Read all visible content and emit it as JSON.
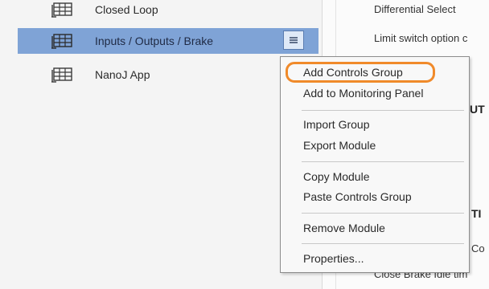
{
  "tree": {
    "items": [
      {
        "label": "Closed Loop"
      },
      {
        "label": "Inputs / Outputs / Brake"
      },
      {
        "label": "NanoJ App"
      }
    ]
  },
  "right_panel": {
    "line1": "Differential Select",
    "line2": "Limit switch option c",
    "head1": "UT",
    "head2": "TI",
    "line3": "Co",
    "line4": "Close Brake Idle tim"
  },
  "context_menu": {
    "items": [
      "Add Controls Group",
      "Add to Monitoring Panel",
      "Import Group",
      "Export Module",
      "Copy Module",
      "Paste Controls Group",
      "Remove Module",
      "Properties..."
    ],
    "highlight_color": "#f08a2a"
  },
  "colors": {
    "selection": "#7fa3d6",
    "menu_button_border": "#5a7cb0"
  }
}
